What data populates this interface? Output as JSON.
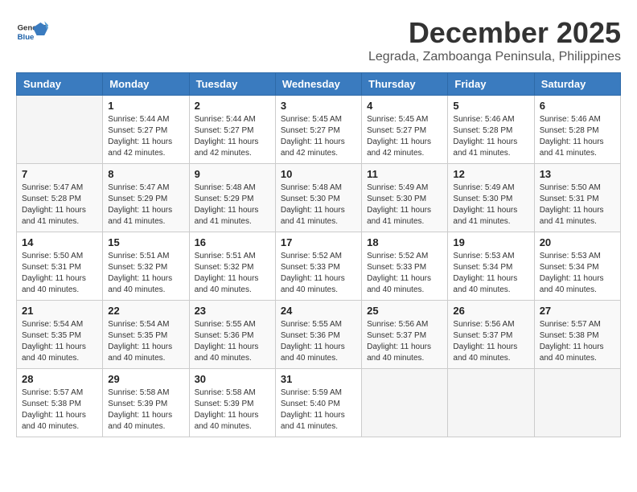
{
  "logo": {
    "general": "General",
    "blue": "Blue"
  },
  "title": "December 2025",
  "subtitle": "Legrada, Zamboanga Peninsula, Philippines",
  "days_header": [
    "Sunday",
    "Monday",
    "Tuesday",
    "Wednesday",
    "Thursday",
    "Friday",
    "Saturday"
  ],
  "weeks": [
    [
      {
        "day": "",
        "info": ""
      },
      {
        "day": "1",
        "info": "Sunrise: 5:44 AM\nSunset: 5:27 PM\nDaylight: 11 hours\nand 42 minutes."
      },
      {
        "day": "2",
        "info": "Sunrise: 5:44 AM\nSunset: 5:27 PM\nDaylight: 11 hours\nand 42 minutes."
      },
      {
        "day": "3",
        "info": "Sunrise: 5:45 AM\nSunset: 5:27 PM\nDaylight: 11 hours\nand 42 minutes."
      },
      {
        "day": "4",
        "info": "Sunrise: 5:45 AM\nSunset: 5:27 PM\nDaylight: 11 hours\nand 42 minutes."
      },
      {
        "day": "5",
        "info": "Sunrise: 5:46 AM\nSunset: 5:28 PM\nDaylight: 11 hours\nand 41 minutes."
      },
      {
        "day": "6",
        "info": "Sunrise: 5:46 AM\nSunset: 5:28 PM\nDaylight: 11 hours\nand 41 minutes."
      }
    ],
    [
      {
        "day": "7",
        "info": "Sunrise: 5:47 AM\nSunset: 5:28 PM\nDaylight: 11 hours\nand 41 minutes."
      },
      {
        "day": "8",
        "info": "Sunrise: 5:47 AM\nSunset: 5:29 PM\nDaylight: 11 hours\nand 41 minutes."
      },
      {
        "day": "9",
        "info": "Sunrise: 5:48 AM\nSunset: 5:29 PM\nDaylight: 11 hours\nand 41 minutes."
      },
      {
        "day": "10",
        "info": "Sunrise: 5:48 AM\nSunset: 5:30 PM\nDaylight: 11 hours\nand 41 minutes."
      },
      {
        "day": "11",
        "info": "Sunrise: 5:49 AM\nSunset: 5:30 PM\nDaylight: 11 hours\nand 41 minutes."
      },
      {
        "day": "12",
        "info": "Sunrise: 5:49 AM\nSunset: 5:30 PM\nDaylight: 11 hours\nand 41 minutes."
      },
      {
        "day": "13",
        "info": "Sunrise: 5:50 AM\nSunset: 5:31 PM\nDaylight: 11 hours\nand 41 minutes."
      }
    ],
    [
      {
        "day": "14",
        "info": "Sunrise: 5:50 AM\nSunset: 5:31 PM\nDaylight: 11 hours\nand 40 minutes."
      },
      {
        "day": "15",
        "info": "Sunrise: 5:51 AM\nSunset: 5:32 PM\nDaylight: 11 hours\nand 40 minutes."
      },
      {
        "day": "16",
        "info": "Sunrise: 5:51 AM\nSunset: 5:32 PM\nDaylight: 11 hours\nand 40 minutes."
      },
      {
        "day": "17",
        "info": "Sunrise: 5:52 AM\nSunset: 5:33 PM\nDaylight: 11 hours\nand 40 minutes."
      },
      {
        "day": "18",
        "info": "Sunrise: 5:52 AM\nSunset: 5:33 PM\nDaylight: 11 hours\nand 40 minutes."
      },
      {
        "day": "19",
        "info": "Sunrise: 5:53 AM\nSunset: 5:34 PM\nDaylight: 11 hours\nand 40 minutes."
      },
      {
        "day": "20",
        "info": "Sunrise: 5:53 AM\nSunset: 5:34 PM\nDaylight: 11 hours\nand 40 minutes."
      }
    ],
    [
      {
        "day": "21",
        "info": "Sunrise: 5:54 AM\nSunset: 5:35 PM\nDaylight: 11 hours\nand 40 minutes."
      },
      {
        "day": "22",
        "info": "Sunrise: 5:54 AM\nSunset: 5:35 PM\nDaylight: 11 hours\nand 40 minutes."
      },
      {
        "day": "23",
        "info": "Sunrise: 5:55 AM\nSunset: 5:36 PM\nDaylight: 11 hours\nand 40 minutes."
      },
      {
        "day": "24",
        "info": "Sunrise: 5:55 AM\nSunset: 5:36 PM\nDaylight: 11 hours\nand 40 minutes."
      },
      {
        "day": "25",
        "info": "Sunrise: 5:56 AM\nSunset: 5:37 PM\nDaylight: 11 hours\nand 40 minutes."
      },
      {
        "day": "26",
        "info": "Sunrise: 5:56 AM\nSunset: 5:37 PM\nDaylight: 11 hours\nand 40 minutes."
      },
      {
        "day": "27",
        "info": "Sunrise: 5:57 AM\nSunset: 5:38 PM\nDaylight: 11 hours\nand 40 minutes."
      }
    ],
    [
      {
        "day": "28",
        "info": "Sunrise: 5:57 AM\nSunset: 5:38 PM\nDaylight: 11 hours\nand 40 minutes."
      },
      {
        "day": "29",
        "info": "Sunrise: 5:58 AM\nSunset: 5:39 PM\nDaylight: 11 hours\nand 40 minutes."
      },
      {
        "day": "30",
        "info": "Sunrise: 5:58 AM\nSunset: 5:39 PM\nDaylight: 11 hours\nand 40 minutes."
      },
      {
        "day": "31",
        "info": "Sunrise: 5:59 AM\nSunset: 5:40 PM\nDaylight: 11 hours\nand 41 minutes."
      },
      {
        "day": "",
        "info": ""
      },
      {
        "day": "",
        "info": ""
      },
      {
        "day": "",
        "info": ""
      }
    ]
  ]
}
